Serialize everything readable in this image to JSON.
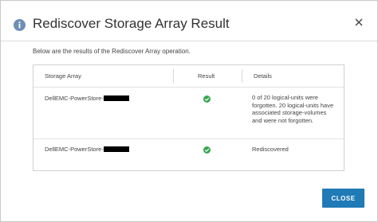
{
  "dialog": {
    "title": "Rediscover Storage Array Result",
    "description": "Below are the results of the Rediscover Array operation.",
    "close_button": "CLOSE"
  },
  "table": {
    "headers": [
      "Storage Array",
      "Result",
      "Details"
    ],
    "rows": [
      {
        "storage_array": "DellEMC-PowerStore-",
        "result": "success",
        "details": "0 of 20 logical-units were forgotten. 20 logical-units have associated storage-volumes and were not forgotten."
      },
      {
        "storage_array": "DellEMC-PowerStore-",
        "result": "success",
        "details": "Rediscovered"
      }
    ]
  },
  "colors": {
    "accent": "#1f7ab6",
    "success": "#38a650",
    "info": "#6d8fb5"
  },
  "icons": [
    "info-icon",
    "close-icon",
    "check-circle-icon"
  ]
}
